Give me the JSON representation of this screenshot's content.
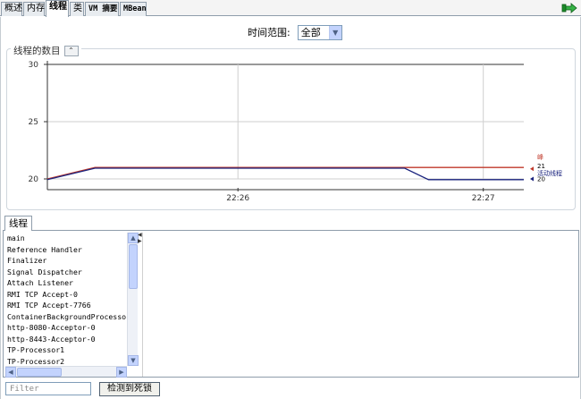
{
  "tabs": [
    {
      "label": "概述",
      "active": false
    },
    {
      "label": "内存",
      "active": false
    },
    {
      "label": "线程",
      "active": true
    },
    {
      "label": "类",
      "active": false
    },
    {
      "label": "VM 摘要",
      "active": false
    },
    {
      "label": "MBean",
      "active": false
    }
  ],
  "time_range": {
    "label": "时间范围:",
    "value": "全部"
  },
  "chart_panel": {
    "title": "线程的数目"
  },
  "chart_data": {
    "type": "line",
    "title": "线程的数目",
    "ylim": [
      20,
      30
    ],
    "yticks": [
      "30",
      "25",
      "20"
    ],
    "xticks": [
      "22:26",
      "22:27"
    ],
    "grid": true,
    "series": [
      {
        "name": "峰",
        "color": "#c0392b",
        "x": [
          0,
          0.1,
          0.75,
          1.0
        ],
        "values": [
          20,
          21,
          21,
          21
        ]
      },
      {
        "name": "活动线程",
        "color": "#1a237e",
        "x": [
          0,
          0.1,
          0.75,
          0.8,
          1.0
        ],
        "values": [
          20,
          21,
          21,
          20,
          20
        ]
      }
    ],
    "legend": [
      {
        "label": "峰",
        "value": "21",
        "color": "#c0392b"
      },
      {
        "label": "活动线程",
        "value": "20",
        "color": "#1a237e"
      }
    ]
  },
  "lower_tab": {
    "label": "线程"
  },
  "threads": [
    "main",
    "Reference Handler",
    "Finalizer",
    "Signal Dispatcher",
    "Attach Listener",
    "RMI TCP Accept-0",
    "RMI TCP Accept-7766",
    "ContainerBackgroundProcessor[S",
    "http-8080-Acceptor-0",
    "http-8443-Acceptor-0",
    "TP-Processor1",
    "TP-Processor2"
  ],
  "filter": {
    "placeholder": "Filter"
  },
  "deadlock_button": {
    "label": "检测到死锁"
  },
  "icons": {
    "detach": "green-arrow-icon"
  }
}
